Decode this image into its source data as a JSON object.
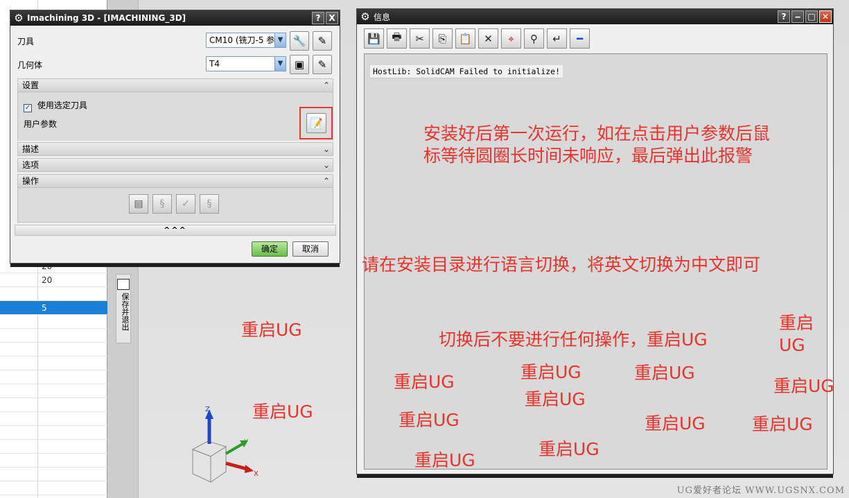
{
  "background": {
    "grid_values": [
      "20",
      "20",
      "5"
    ],
    "side_tab_label": "保存并退出"
  },
  "dialog": {
    "title": "Imachining 3D - [IMACHINING_3D]",
    "help": "?",
    "close": "X",
    "tool_label": "刀具",
    "tool_value": "CM10 (铣刀-5 参",
    "geometry_label": "几何体",
    "geometry_value": "T4",
    "settings_header": "设置",
    "use_selected_tool_label": "使用选定刀具",
    "use_selected_tool_checked": true,
    "user_params_label": "用户参数",
    "description_header": "描述",
    "options_header": "选项",
    "operation_header": "操作",
    "expander": "^^^",
    "ok": "确定",
    "cancel": "取消"
  },
  "info_window": {
    "title": "信息",
    "help": "?",
    "message": "HostLib: SolidCAM Failed to initialize!",
    "toolbar": [
      "save-icon",
      "print-icon",
      "cut-icon",
      "copy-icon",
      "paste-icon",
      "delete-icon",
      "target-icon",
      "binoculars-icon",
      "wrap-icon",
      "minus-icon"
    ]
  },
  "triad": {
    "z": "Z",
    "y": "Y",
    "x": "X"
  },
  "annotations": {
    "note1_line1": "安装好后第一次运行，如在点击用户参数后鼠",
    "note1_line2": "标等待圆圈长时间未响应，最后弹出此报警",
    "note2": "请在安装目录进行语言切换，将英文切换为中文即可",
    "note3": "切换后不要进行任何操作，重启UG",
    "restart": "重启UG",
    "restart_top": "重启",
    "restart_bottom": "UG"
  },
  "colors": {
    "annotation_red": "#e8332c",
    "highlight_red": "#e53935",
    "selection_blue": "#1a7fd6",
    "titlebar_dark": "#1b1b1b"
  },
  "watermark": "UG爱好者论坛 WWW.UGSNX.COM"
}
